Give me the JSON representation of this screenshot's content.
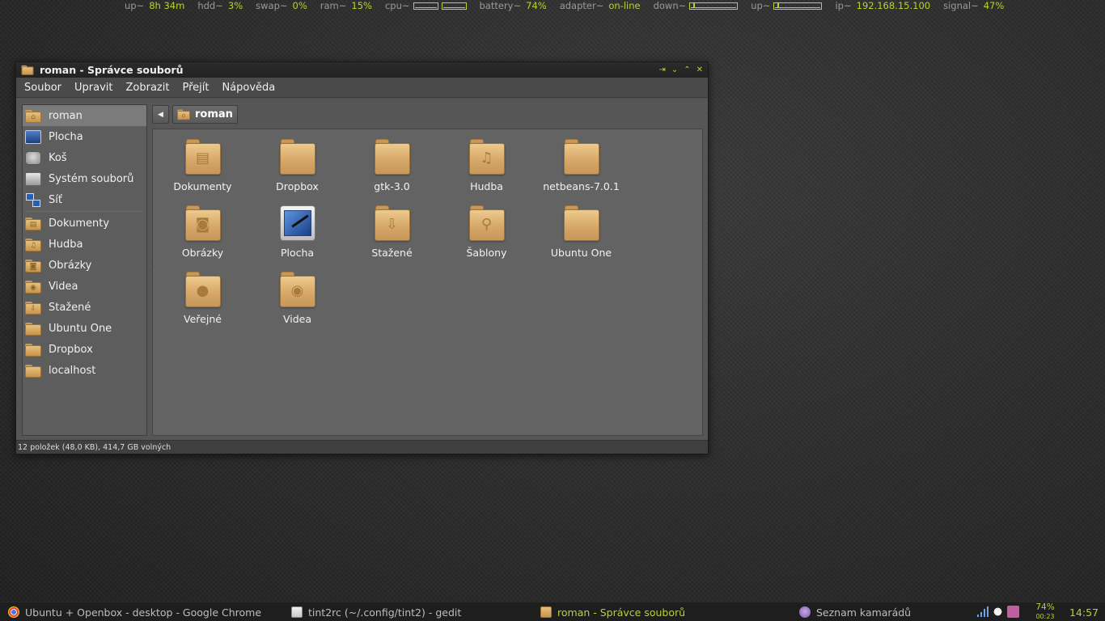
{
  "conky": [
    {
      "label": "up~",
      "value": "8h 34m"
    },
    {
      "label": "hdd~",
      "value": "3%"
    },
    {
      "label": "swap~",
      "value": "0%"
    },
    {
      "label": "ram~",
      "value": "15%"
    },
    {
      "label": "cpu~",
      "value": ""
    },
    {
      "label": "battery~",
      "value": "74%"
    },
    {
      "label": "adapter~",
      "value": "on-line"
    },
    {
      "label": "down~",
      "value": ""
    },
    {
      "label": "up~",
      "value": ""
    },
    {
      "label": "ip~",
      "value": "192.168.15.100"
    },
    {
      "label": "signal~",
      "value": "47%"
    }
  ],
  "window": {
    "title": "roman - Správce souborů",
    "buttons": [
      "⇥",
      "⌄",
      "⌃",
      "✕"
    ],
    "menu": [
      "Soubor",
      "Upravit",
      "Zobrazit",
      "Přejít",
      "Nápověda"
    ],
    "sidebar": {
      "places": [
        {
          "name": "roman",
          "icon": "home-folder-icon",
          "glyph": "⌂",
          "active": true
        },
        {
          "name": "Plocha",
          "icon": "desktop-icon"
        },
        {
          "name": "Koš",
          "icon": "trash-icon"
        },
        {
          "name": "Systém souborů",
          "icon": "drive-icon"
        },
        {
          "name": "Síť",
          "icon": "network-icon"
        }
      ],
      "bookmarks": [
        {
          "name": "Dokumenty",
          "icon": "documents-folder-icon",
          "glyph": "▤"
        },
        {
          "name": "Hudba",
          "icon": "music-folder-icon",
          "glyph": "♫"
        },
        {
          "name": "Obrázky",
          "icon": "pictures-folder-icon",
          "glyph": "◙"
        },
        {
          "name": "Videa",
          "icon": "videos-folder-icon",
          "glyph": "◉"
        },
        {
          "name": "Stažené",
          "icon": "downloads-folder-icon",
          "glyph": "⇩"
        },
        {
          "name": "Ubuntu One",
          "icon": "folder-icon",
          "glyph": ""
        },
        {
          "name": "Dropbox",
          "icon": "folder-icon",
          "glyph": ""
        },
        {
          "name": "localhost",
          "icon": "folder-icon",
          "glyph": ""
        }
      ]
    },
    "path": {
      "back": "◀",
      "current": "roman"
    },
    "files": [
      {
        "name": "Dokumenty",
        "icon": "documents-folder-icon",
        "glyph": "▤"
      },
      {
        "name": "Dropbox",
        "icon": "folder-icon",
        "glyph": ""
      },
      {
        "name": "gtk-3.0",
        "icon": "folder-icon",
        "glyph": ""
      },
      {
        "name": "Hudba",
        "icon": "music-folder-icon",
        "glyph": "♫"
      },
      {
        "name": "netbeans-7.0.1",
        "icon": "folder-icon",
        "glyph": ""
      },
      {
        "name": "Obrázky",
        "icon": "pictures-folder-icon",
        "glyph": "◙"
      },
      {
        "name": "Plocha",
        "icon": "desktop-icon",
        "glyph": ""
      },
      {
        "name": "Stažené",
        "icon": "downloads-folder-icon",
        "glyph": "⇩"
      },
      {
        "name": "Šablony",
        "icon": "templates-folder-icon",
        "glyph": "⚲"
      },
      {
        "name": "Ubuntu One",
        "icon": "folder-icon",
        "glyph": ""
      },
      {
        "name": "Veřejné",
        "icon": "public-folder-icon",
        "glyph": "●"
      },
      {
        "name": "Videa",
        "icon": "videos-folder-icon",
        "glyph": "◉"
      }
    ],
    "status": "12 položek (48,0 KB), 414,7 GB volných"
  },
  "taskbar": {
    "tasks": [
      {
        "name": "Ubuntu + Openbox - desktop - Google Chrome",
        "icon": "chrome-icon",
        "active": false
      },
      {
        "name": "tint2rc (~/.config/tint2) - gedit",
        "icon": "gedit-icon",
        "active": false
      },
      {
        "name": "roman - Správce souborů",
        "icon": "folder-icon",
        "active": true
      },
      {
        "name": "Seznam kamarádů",
        "icon": "pidgin-icon",
        "active": false
      }
    ],
    "battery": {
      "percent": "74%",
      "time": "00:23"
    },
    "clock": "14:57"
  },
  "colors": {
    "accent": "#b6d42a",
    "folder": "#d4a566"
  }
}
